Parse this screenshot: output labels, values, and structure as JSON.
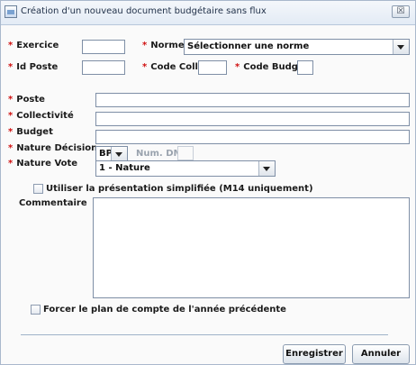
{
  "window": {
    "title": "Création d'un nouveau document budgétaire sans flux",
    "close_glyph": "☒"
  },
  "form": {
    "exercice_label": "Exercice",
    "norme_label": "Norme",
    "norme_value": "Sélectionner une norme",
    "id_poste_label": "Id Poste",
    "code_coll_label": "Code Coll.",
    "code_budg_label": "Code Budg.",
    "poste_label": "Poste",
    "collectivite_label": "Collectivité",
    "budget_label": "Budget",
    "nature_decision_label": "Nature Décision",
    "nature_decision_value": "BP",
    "num_dm_label": "Num. DM",
    "nature_vote_label": "Nature Vote",
    "nature_vote_value": "1 - Nature",
    "simplified_label": "Utiliser la présentation simplifiée (M14 uniquement)",
    "commentaire_label": "Commentaire",
    "force_plan_label": "Forcer le plan de compte de l'année précédente"
  },
  "buttons": {
    "save": "Enregistrer",
    "cancel": "Annuler"
  },
  "required_marker": "*"
}
